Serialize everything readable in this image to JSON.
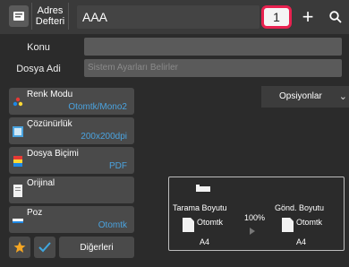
{
  "header": {
    "address_book_label": "Adres Defteri",
    "address_value": "AAA",
    "destination_count": "1",
    "plus_glyph": "+"
  },
  "fields": {
    "subject_label": "Konu",
    "subject_value": "",
    "filename_label": "Dosya Adi",
    "filename_placeholder": "Sistem Ayarları Belirler"
  },
  "settings": [
    {
      "title": "Renk Modu",
      "value": "Otomtk/Mono2"
    },
    {
      "title": "Çözünürlük",
      "value": "200x200dpi"
    },
    {
      "title": "Dosya Biçimi",
      "value": "PDF"
    },
    {
      "title": "Orijinal",
      "value": ""
    },
    {
      "title": "Poz",
      "value": "Otomtk"
    }
  ],
  "options": {
    "label": "Opsiyonlar",
    "chevron": "⌄"
  },
  "preview": {
    "scan_size_label": "Tarama Boyutu",
    "scan_mode": "Otomtk",
    "scan_paper": "A4",
    "ratio": "100%",
    "send_size_label": "Gönd. Boyutu",
    "send_mode": "Otomtk",
    "send_paper": "A4"
  },
  "bottom": {
    "others_label": "Diğerleri"
  },
  "colors": {
    "accent": "#4aa3df",
    "highlight_border": "#e8214f",
    "favorite": "#f5a623",
    "check": "#3fa7e0"
  }
}
